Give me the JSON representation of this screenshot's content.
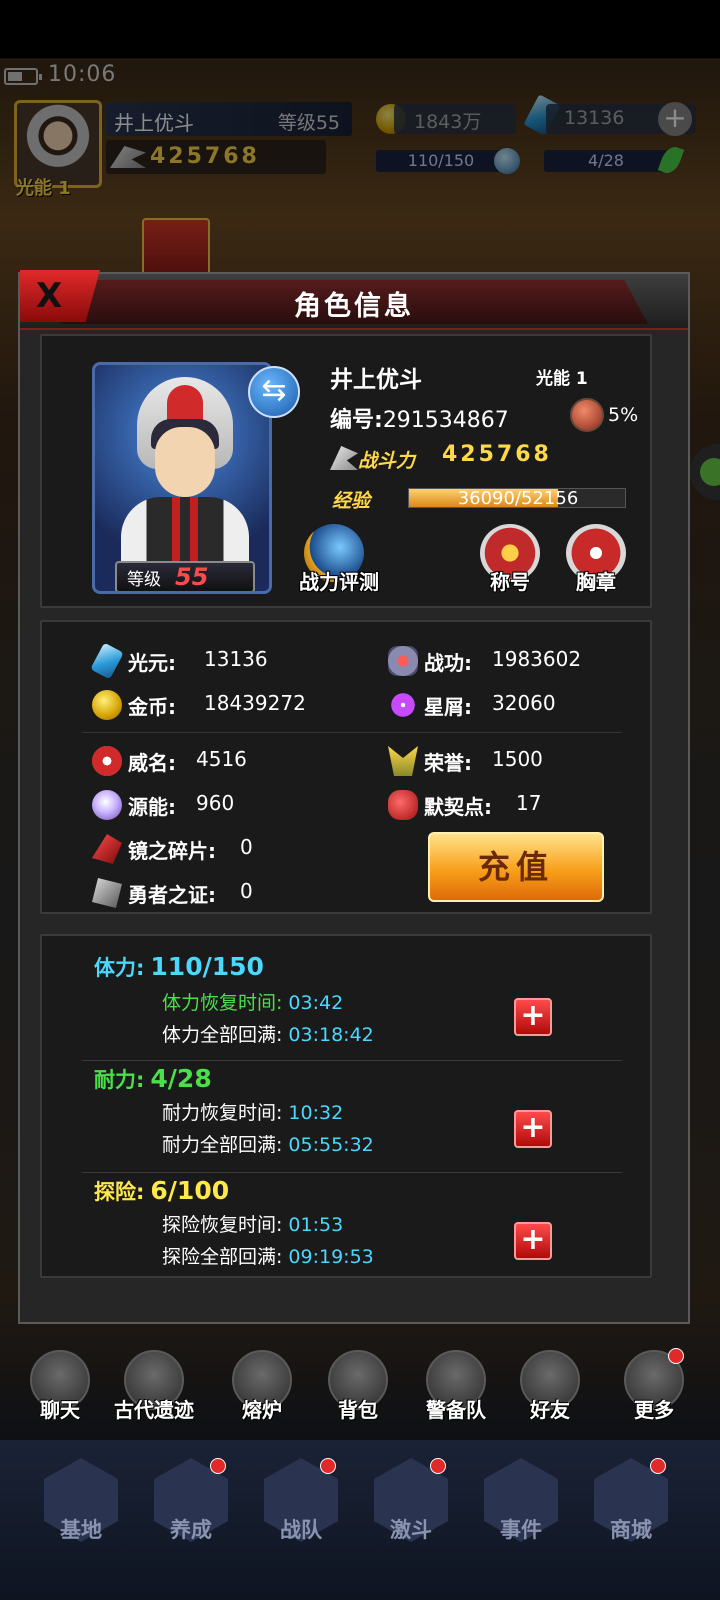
{
  "status_bar": {
    "time": "10:06"
  },
  "hud": {
    "avatar_tag": "光能 1",
    "player_name": "井上优斗",
    "level": "等级55",
    "power": "425768",
    "gold": "1843万",
    "gems": "13136",
    "stamina": "110/150",
    "endurance": "4/28"
  },
  "modal": {
    "title": "角色信息",
    "close_label": "X",
    "profile": {
      "name": "井上优斗",
      "shine": "光能 1",
      "id_label": "编号:",
      "id_value": "291534867",
      "rate": "5%",
      "power_label": "战斗力",
      "power_value": "425768",
      "exp_label": "经验",
      "exp_text": "36090/52156",
      "exp_fraction": 0.692,
      "level_label": "等级",
      "level_value": "55",
      "swap_icon": "⇆",
      "btn_eval": "战力评测",
      "btn_title": "称号",
      "btn_badge": "胸章"
    },
    "resources": {
      "gem_label": "光元:",
      "gem_value": "13136",
      "coin_label": "金币:",
      "coin_value": "18439272",
      "fame_label": "威名:",
      "fame_value": "4516",
      "energy_label": "源能:",
      "energy_value": "960",
      "shard_label": "镜之碎片:",
      "shard_value": "0",
      "proof_label": "勇者之证:",
      "proof_value": "0",
      "merit_label": "战功:",
      "merit_value": "1983602",
      "star_label": "星屑:",
      "star_value": "32060",
      "honor_label": "荣誉:",
      "honor_value": "1500",
      "pact_label": "默契点:",
      "pact_value": "17",
      "recharge_label": "充值"
    },
    "stamina": {
      "label": "体力:",
      "value": "110/150",
      "recover_label": "体力恢复时间:",
      "recover_time": "03:42",
      "full_label": "体力全部回满:",
      "full_time": "03:18:42"
    },
    "endurance": {
      "label": "耐力:",
      "value": "4/28",
      "recover_label": "耐力恢复时间:",
      "recover_time": "10:32",
      "full_label": "耐力全部回满:",
      "full_time": "05:55:32"
    },
    "explore": {
      "label": "探险:",
      "value": "6/100",
      "recover_label": "探险恢复时间:",
      "recover_time": "01:53",
      "full_label": "探险全部回满:",
      "full_time": "09:19:53"
    },
    "plus_symbol": "+"
  },
  "menu": [
    "聊天",
    "古代遗迹",
    "熔炉",
    "背包",
    "警备队",
    "好友",
    "更多"
  ],
  "nav": [
    "基地",
    "养成",
    "战队",
    "激斗",
    "事件",
    "商城"
  ],
  "colors": {
    "accent_gold": "#ffd84a",
    "cyan": "#4ad8ff",
    "green": "#4ae04a",
    "yellow": "#ffe84a",
    "danger": "#e02a2a"
  }
}
